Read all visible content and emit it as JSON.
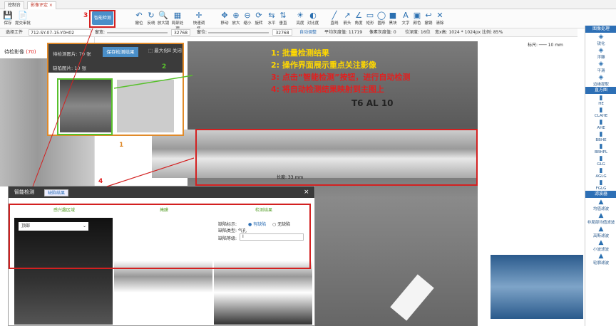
{
  "tabs": [
    {
      "label": "控制台"
    },
    {
      "label": "影像评定"
    }
  ],
  "toolbar": {
    "left": [
      {
        "label": "保存",
        "icon": "save-icon"
      },
      {
        "label": "提交审批",
        "icon": "submit-icon"
      }
    ],
    "smart_detect": "智能检测",
    "tools": [
      "撤位",
      "反绕",
      "放大镜",
      "局部处理",
      "快速调集",
      "移动",
      "放大",
      "缩小",
      "旋转",
      "水平",
      "垂直",
      "亮度",
      "对比度",
      "直线",
      "箭头",
      "角度",
      "矩形",
      "圆形",
      "黑块",
      "文字",
      "颜色",
      "撤销",
      "清除"
    ]
  },
  "params": {
    "file_label": "选择工件",
    "file_value": "712-SY-07-15-Y0H02",
    "window_label": "窗宽:",
    "window_value": "32768",
    "level_label": "窗位:",
    "level_value": "32768",
    "auto_btn": "自动调整",
    "avg_gray": "平均灰度值: 11719",
    "pixel_gray": "像素灰度值: 0",
    "bit_depth": "位深度: 16位",
    "resolution": "宽x高: 1024 * 1024px",
    "scale": "比例: 85%",
    "ruler": "标尺: ─── 10 mm"
  },
  "left": {
    "pending": "待检影像",
    "pending_count": "(70)"
  },
  "popup": {
    "pending_label": "待检测图片: 70 张",
    "defect_label": "缺陷图片: 10 张",
    "save_btn": "保存检测结果",
    "maximize": "最大化",
    "close": "关闭"
  },
  "annotations": {
    "step1": "1: 批量检测结果",
    "step2": "2: 操作界面展示重点关注影像",
    "step3": "3: 点击“智能检测”按钮，进行自动检测",
    "step4": "4: 将自动检测结果映射到主图上"
  },
  "markers": [
    "1",
    "2",
    "3",
    "4"
  ],
  "image_text": {
    "film_code": "T6 AL 10",
    "length": "长度: 33 mm"
  },
  "dialog": {
    "title": "智能检测",
    "tab": "缺陷结果",
    "close": "×",
    "steps": [
      "感兴趣区域",
      "掩膜",
      "检测结果"
    ],
    "region_select": "顶部",
    "defect_label": "缺陷标示:",
    "defect_yes": "有缺陷",
    "defect_no": "无缺陷",
    "type_label": "缺陷类型: 气孔",
    "level_label": "缺陷等级:",
    "level_value": "I"
  },
  "right_panel": {
    "sec1": "图像处理",
    "items1": [
      "锐化",
      "浮雕",
      "平滑",
      "边缘提取"
    ],
    "sec2": "直方图",
    "items2": [
      "HE",
      "CLAHE",
      "AHE",
      "BBHE",
      "BBHPL",
      "GLG",
      "AGLG",
      "FGLG"
    ],
    "sec3": "滤波器",
    "items3": [
      "均值滤波",
      "非局部均值滤波",
      "高斯滤波",
      "小波滤波",
      "轮廓滤波"
    ]
  },
  "colors": {
    "accent": "#2d6fb5",
    "annot_red": "#e02020",
    "annot_yellow": "#ffd800",
    "box_green": "#58c12c",
    "box_orange": "#e08a2a"
  }
}
